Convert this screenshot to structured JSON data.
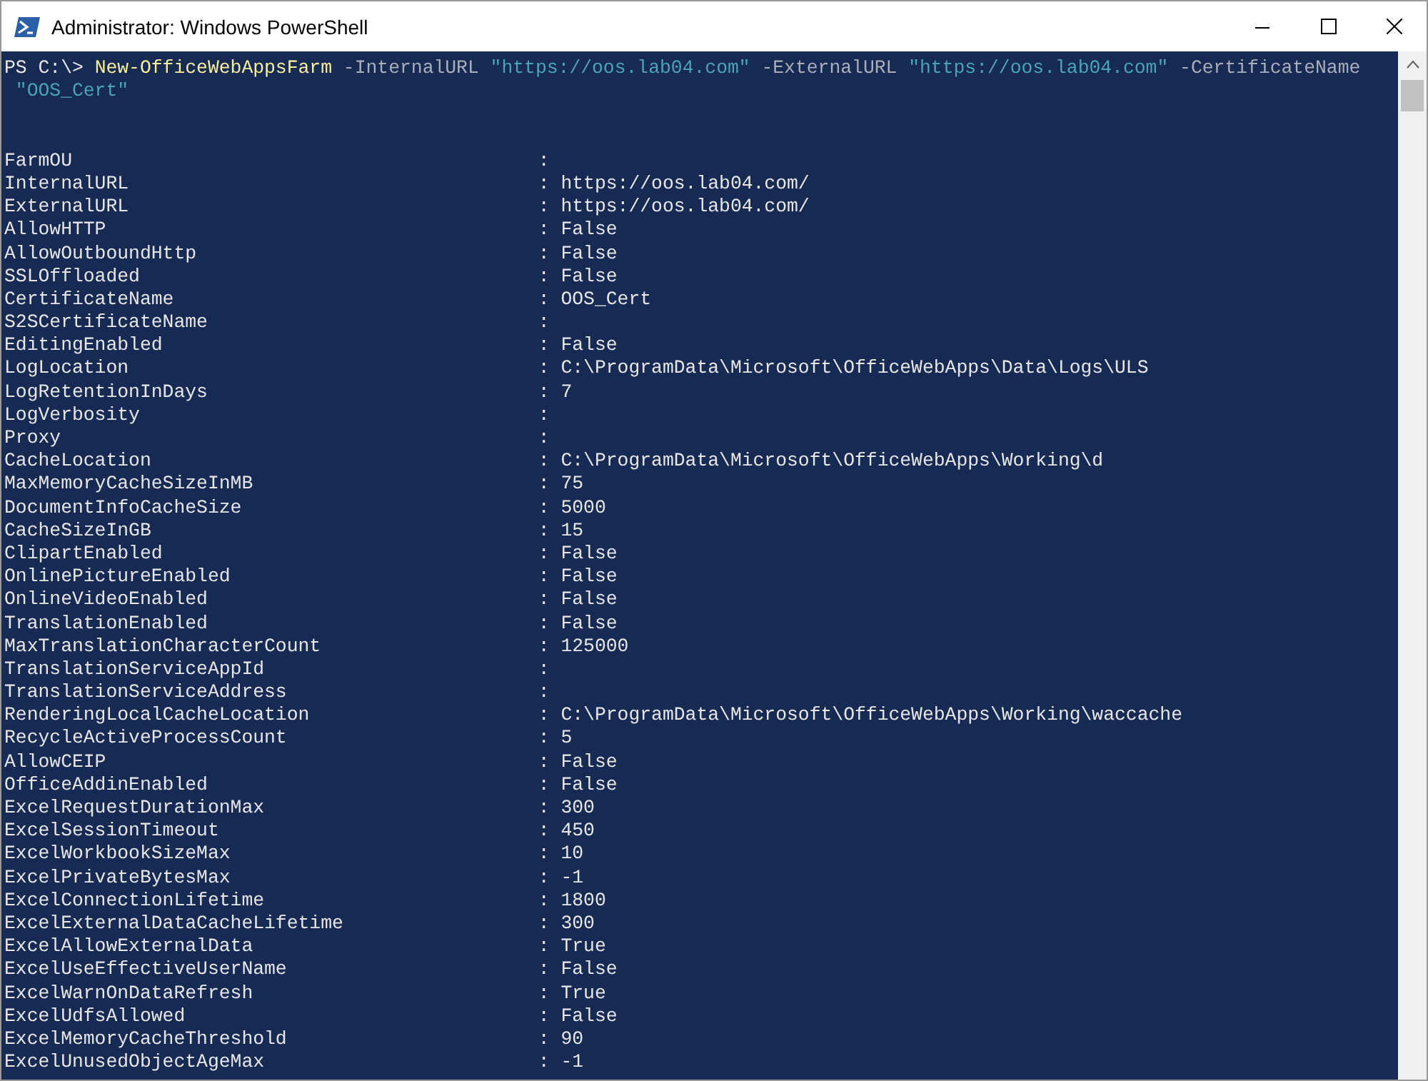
{
  "window": {
    "title": "Administrator: Windows PowerShell"
  },
  "command_lines": [
    [
      {
        "kind": "prompt",
        "text": "PS C:\\>"
      },
      {
        "kind": "command",
        "text": "New-OfficeWebAppsFarm"
      },
      {
        "kind": "parameter",
        "text": "-InternalURL"
      },
      {
        "kind": "string",
        "text": "\"https://oos.lab04.com\""
      },
      {
        "kind": "parameter",
        "text": "-ExternalURL"
      },
      {
        "kind": "string",
        "text": "\"https://oos.lab04.com\""
      },
      {
        "kind": "parameter",
        "text": "-CertificateName"
      }
    ],
    [
      {
        "kind": "string",
        "text": "\"OOS_Cert\""
      }
    ]
  ],
  "separator": ":",
  "properties": [
    {
      "name": "FarmOU"
    },
    {
      "name": "InternalURL",
      "value": "https://oos.lab04.com/"
    },
    {
      "name": "ExternalURL",
      "value": "https://oos.lab04.com/"
    },
    {
      "name": "AllowHTTP",
      "value": "False"
    },
    {
      "name": "AllowOutboundHttp",
      "value": "False"
    },
    {
      "name": "SSLOffloaded",
      "value": "False"
    },
    {
      "name": "CertificateName",
      "value": "OOS_Cert"
    },
    {
      "name": "S2SCertificateName"
    },
    {
      "name": "EditingEnabled",
      "value": "False"
    },
    {
      "name": "LogLocation",
      "value": "C:\\ProgramData\\Microsoft\\OfficeWebApps\\Data\\Logs\\ULS"
    },
    {
      "name": "LogRetentionInDays",
      "value": "7"
    },
    {
      "name": "LogVerbosity"
    },
    {
      "name": "Proxy"
    },
    {
      "name": "CacheLocation",
      "value": "C:\\ProgramData\\Microsoft\\OfficeWebApps\\Working\\d"
    },
    {
      "name": "MaxMemoryCacheSizeInMB",
      "value": "75"
    },
    {
      "name": "DocumentInfoCacheSize",
      "value": "5000"
    },
    {
      "name": "CacheSizeInGB",
      "value": "15"
    },
    {
      "name": "ClipartEnabled",
      "value": "False"
    },
    {
      "name": "OnlinePictureEnabled",
      "value": "False"
    },
    {
      "name": "OnlineVideoEnabled",
      "value": "False"
    },
    {
      "name": "TranslationEnabled",
      "value": "False"
    },
    {
      "name": "MaxTranslationCharacterCount",
      "value": "125000"
    },
    {
      "name": "TranslationServiceAppId"
    },
    {
      "name": "TranslationServiceAddress"
    },
    {
      "name": "RenderingLocalCacheLocation",
      "value": "C:\\ProgramData\\Microsoft\\OfficeWebApps\\Working\\waccache"
    },
    {
      "name": "RecycleActiveProcessCount",
      "value": "5"
    },
    {
      "name": "AllowCEIP",
      "value": "False"
    },
    {
      "name": "OfficeAddinEnabled",
      "value": "False"
    },
    {
      "name": "ExcelRequestDurationMax",
      "value": "300"
    },
    {
      "name": "ExcelSessionTimeout",
      "value": "450"
    },
    {
      "name": "ExcelWorkbookSizeMax",
      "value": "10"
    },
    {
      "name": "ExcelPrivateBytesMax",
      "value": "-1"
    },
    {
      "name": "ExcelConnectionLifetime",
      "value": "1800"
    },
    {
      "name": "ExcelExternalDataCacheLifetime",
      "value": "300"
    },
    {
      "name": "ExcelAllowExternalData",
      "value": "True"
    },
    {
      "name": "ExcelUseEffectiveUserName",
      "value": "False"
    },
    {
      "name": "ExcelWarnOnDataRefresh",
      "value": "True"
    },
    {
      "name": "ExcelUdfsAllowed",
      "value": "False"
    },
    {
      "name": "ExcelMemoryCacheThreshold",
      "value": "90"
    },
    {
      "name": "ExcelUnusedObjectAgeMax",
      "value": "-1"
    }
  ]
}
